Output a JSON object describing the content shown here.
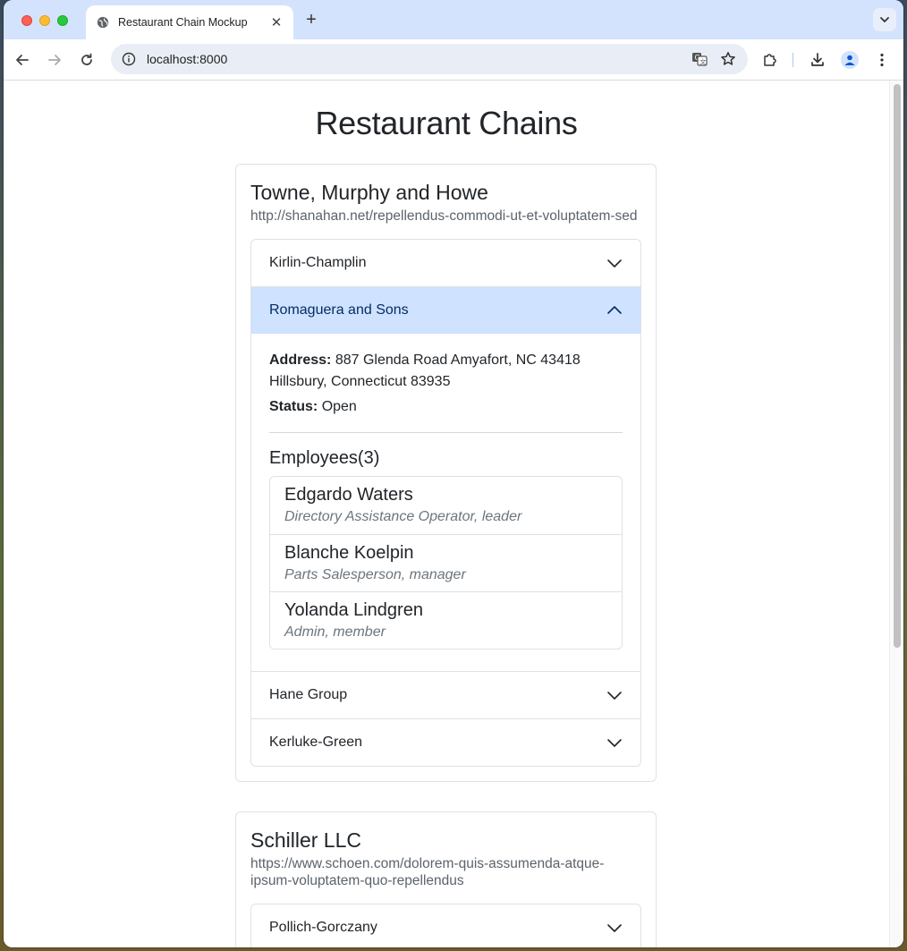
{
  "browser": {
    "tab_title": "Restaurant Chain Mockup",
    "tab_close": "✕",
    "new_tab": "+",
    "url": "localhost:8000"
  },
  "page": {
    "title": "Restaurant Chains"
  },
  "chains": [
    {
      "name": "Towne, Murphy and Howe",
      "url": "http://shanahan.net/repellendus-commodi-ut-et-voluptatem-sed",
      "locations": [
        {
          "name": "Kirlin-Champlin",
          "expanded": false
        },
        {
          "name": "Romaguera and Sons",
          "expanded": true,
          "address_label": "Address:",
          "address": "887 Glenda Road Amyafort, NC 43418 Hillsbury, Connecticut 83935",
          "status_label": "Status:",
          "status": "Open",
          "employees_title": "Employees(3)",
          "employees": [
            {
              "name": "Edgardo Waters",
              "role": "Directory Assistance Operator, leader"
            },
            {
              "name": "Blanche Koelpin",
              "role": "Parts Salesperson, manager"
            },
            {
              "name": "Yolanda Lindgren",
              "role": "Admin, member"
            }
          ]
        },
        {
          "name": "Hane Group",
          "expanded": false
        },
        {
          "name": "Kerluke-Green",
          "expanded": false
        }
      ]
    },
    {
      "name": "Schiller LLC",
      "url": "https://www.schoen.com/dolorem-quis-assumenda-atque-ipsum-voluptatem-quo-repellendus",
      "locations": [
        {
          "name": "Pollich-Gorczany",
          "expanded": false
        }
      ]
    }
  ]
}
